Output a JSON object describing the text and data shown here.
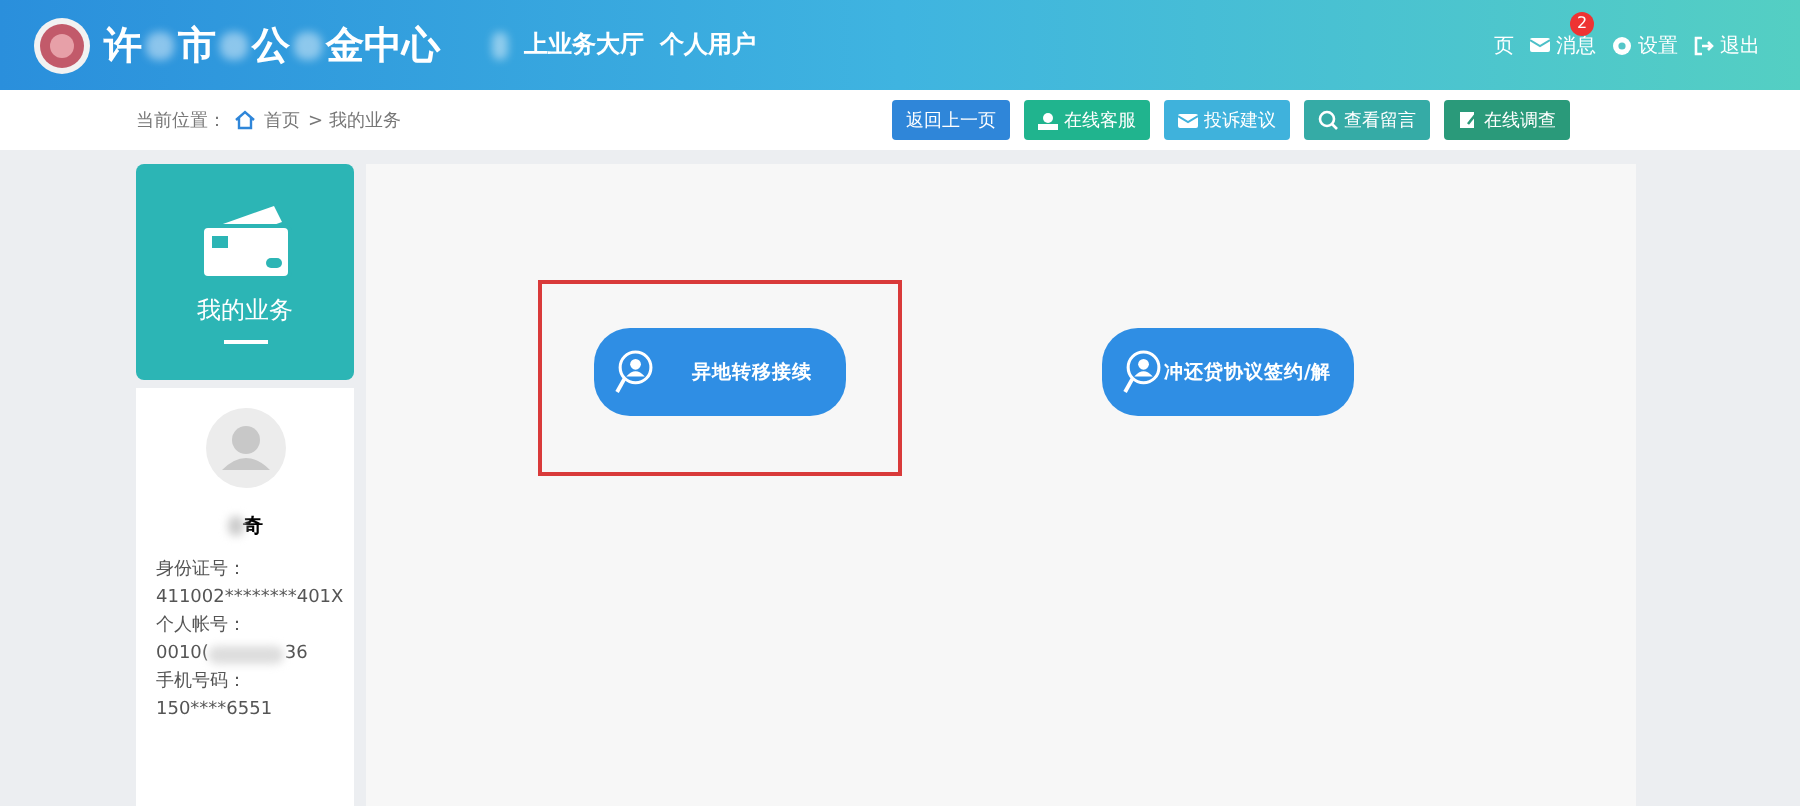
{
  "header": {
    "title_parts": [
      "许",
      "市",
      "公",
      "金中心"
    ],
    "nav": [
      "上业务大厅",
      "个人用户"
    ],
    "links": [
      {
        "kind": "plain",
        "label": "页"
      },
      {
        "kind": "mail",
        "label": "消息",
        "badge": "2"
      },
      {
        "kind": "gear",
        "label": "设置"
      },
      {
        "kind": "exit",
        "label": "退出"
      }
    ]
  },
  "breadcrumb": {
    "label": "当前位置：",
    "home": "首页",
    "current": " > 我的业务"
  },
  "actions": [
    {
      "kind": "back",
      "label": "返回上一页",
      "color": "#2f86d9"
    },
    {
      "kind": "service",
      "label": "在线客服",
      "color": "#20b48e"
    },
    {
      "kind": "mail",
      "label": "投诉建议",
      "color": "#3fb2dc"
    },
    {
      "kind": "search",
      "label": "查看留言",
      "color": "#35aba6"
    },
    {
      "kind": "edit",
      "label": "在线调查",
      "color": "#2a9a7a"
    }
  ],
  "sidebar": {
    "card_label": "我的业务",
    "name": "奇",
    "fields": [
      {
        "label": "身份证号：",
        "value": [
          "411002********401X"
        ]
      },
      {
        "label": "个人帐号：",
        "value": [
          "0010(",
          "36"
        ]
      },
      {
        "label": "手机号码：",
        "value": [
          "150****6551"
        ]
      }
    ]
  },
  "services": [
    {
      "label": "异地转移接续",
      "selected": true
    },
    {
      "label": "冲还贷协议签约/解",
      "selected": false
    }
  ]
}
